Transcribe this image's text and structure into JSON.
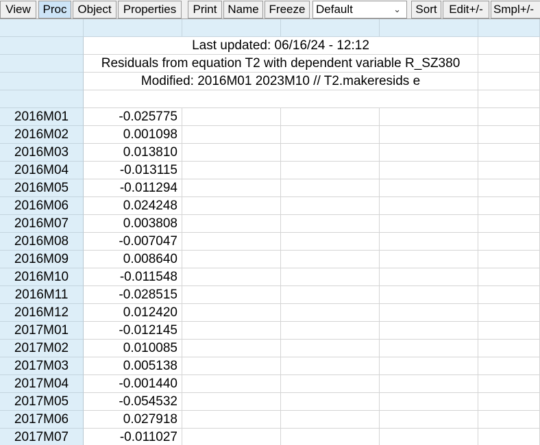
{
  "toolbar": {
    "buttons": [
      "View",
      "Proc",
      "Object",
      "Properties",
      "Print",
      "Name",
      "Freeze"
    ],
    "active": "Proc",
    "select_value": "Default",
    "buttons_right": [
      "Sort",
      "Edit+/-",
      "Smpl+/-"
    ]
  },
  "header": {
    "last_updated": "Last updated: 06/16/24 - 12:12",
    "description": "Residuals from equation T2 with dependent variable R_SZ380",
    "modified": "Modified: 2016M01 2023M10 // T2.makeresids e"
  },
  "rows": [
    {
      "date": "2016M01",
      "value": "-0.025775"
    },
    {
      "date": "2016M02",
      "value": "0.001098"
    },
    {
      "date": "2016M03",
      "value": "0.013810"
    },
    {
      "date": "2016M04",
      "value": "-0.013115"
    },
    {
      "date": "2016M05",
      "value": "-0.011294"
    },
    {
      "date": "2016M06",
      "value": "0.024248"
    },
    {
      "date": "2016M07",
      "value": "0.003808"
    },
    {
      "date": "2016M08",
      "value": "-0.007047"
    },
    {
      "date": "2016M09",
      "value": "0.008640"
    },
    {
      "date": "2016M10",
      "value": "-0.011548"
    },
    {
      "date": "2016M11",
      "value": "-0.028515"
    },
    {
      "date": "2016M12",
      "value": "0.012420"
    },
    {
      "date": "2017M01",
      "value": "-0.012145"
    },
    {
      "date": "2017M02",
      "value": "0.010085"
    },
    {
      "date": "2017M03",
      "value": "0.005138"
    },
    {
      "date": "2017M04",
      "value": "-0.001440"
    },
    {
      "date": "2017M05",
      "value": "-0.054532"
    },
    {
      "date": "2017M06",
      "value": "0.027918"
    },
    {
      "date": "2017M07",
      "value": "-0.011027"
    }
  ]
}
